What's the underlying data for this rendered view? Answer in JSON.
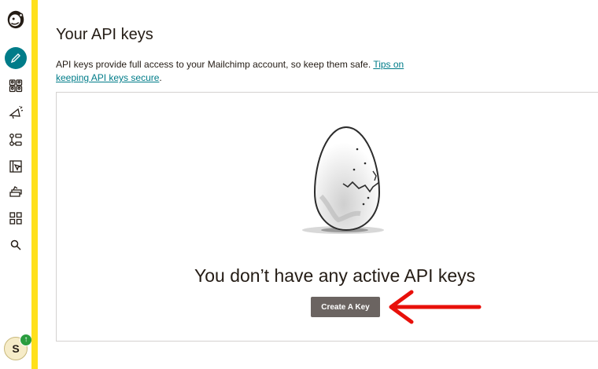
{
  "sidebar": {
    "logo_icon": "mailchimp-freddie-icon",
    "items": [
      {
        "name": "create",
        "icon": "pencil-icon",
        "active": true
      },
      {
        "name": "audience",
        "icon": "audience-icon"
      },
      {
        "name": "campaigns",
        "icon": "megaphone-icon"
      },
      {
        "name": "automations",
        "icon": "automation-flow-icon"
      },
      {
        "name": "website",
        "icon": "website-icon"
      },
      {
        "name": "content",
        "icon": "content-studio-icon"
      },
      {
        "name": "integrations",
        "icon": "grid-icon"
      },
      {
        "name": "search",
        "icon": "search-icon"
      }
    ],
    "account_initial": "S",
    "account_badge_icon": "upgrade-arrow-icon"
  },
  "page": {
    "title": "Your API keys",
    "description": "API keys provide full access to your Mailchimp account, so keep them safe. ",
    "tips_link": "Tips on keeping API keys secure",
    "description_end": "."
  },
  "empty_state": {
    "illustration": "cracked-egg-illustration",
    "heading": "You don’t have any active API keys",
    "button_label": "Create A Key"
  },
  "annotation": {
    "arrow_icon": "red-arrow-left-icon",
    "color": "#e8100a"
  },
  "colors": {
    "accent_yellow": "#ffe01b",
    "teal": "#007c89",
    "button_gray": "#6b6461"
  }
}
